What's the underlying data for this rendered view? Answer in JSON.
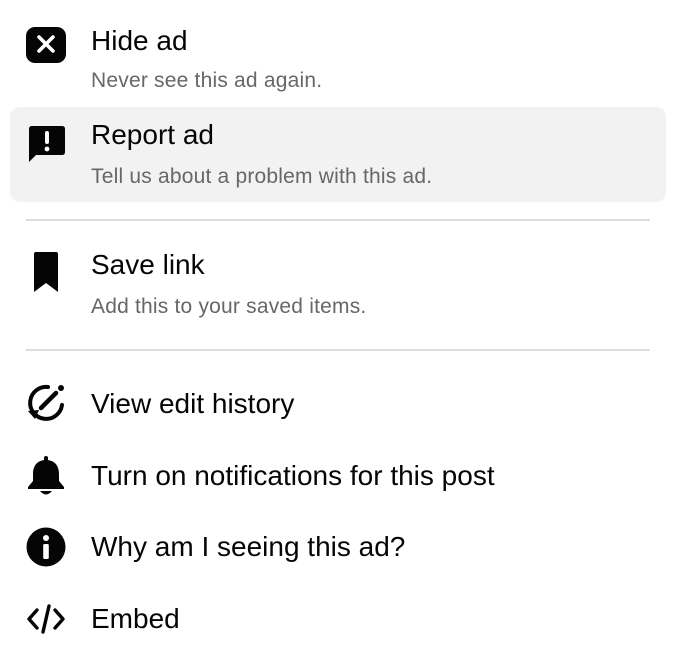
{
  "menu": {
    "hide_ad": {
      "title": "Hide ad",
      "subtitle": "Never see this ad again."
    },
    "report_ad": {
      "title": "Report ad",
      "subtitle": "Tell us about a problem with this ad."
    },
    "save_link": {
      "title": "Save link",
      "subtitle": "Add this to your saved items."
    },
    "view_edit_history": {
      "title": "View edit history"
    },
    "turn_on_notifications": {
      "title": "Turn on notifications for this post"
    },
    "why_seeing_ad": {
      "title": "Why am I seeing this ad?"
    },
    "embed": {
      "title": "Embed"
    }
  },
  "icons": {
    "hide_ad": "close-box-icon",
    "report_ad": "report-flag-icon",
    "save_link": "bookmark-icon",
    "view_edit_history": "edit-history-icon",
    "turn_on_notifications": "bell-icon",
    "why_seeing_ad": "info-icon",
    "embed": "code-icon"
  },
  "colors": {
    "text_primary": "#050505",
    "text_secondary": "#65676b",
    "highlight": "#f2f2f2",
    "divider": "#dadde1"
  }
}
